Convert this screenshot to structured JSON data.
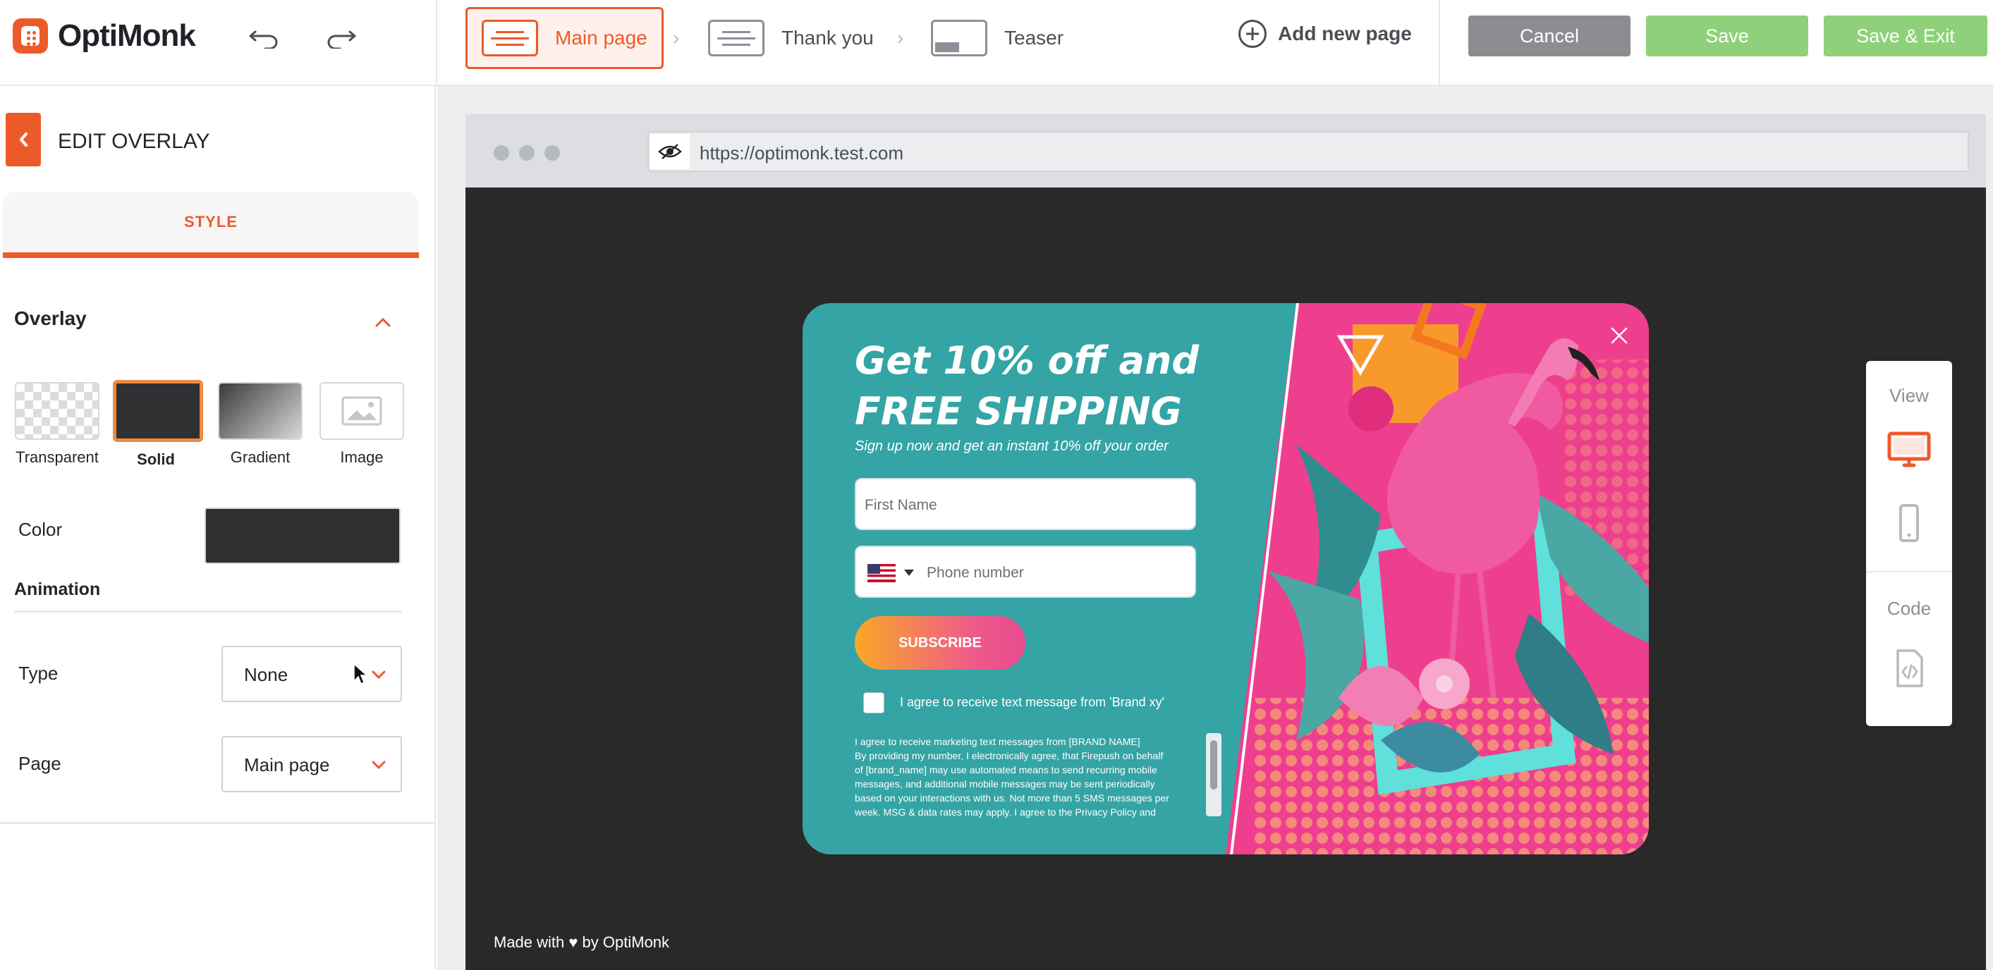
{
  "app": {
    "name": "OptiMonk"
  },
  "toolbar": {
    "undo_icon": "undo-icon",
    "redo_icon": "redo-icon",
    "pages": [
      {
        "label": "Main page",
        "active": true
      },
      {
        "label": "Thank you",
        "active": false
      },
      {
        "label": "Teaser",
        "active": false
      }
    ],
    "add_page_label": "Add new page",
    "cancel_label": "Cancel",
    "save_label": "Save",
    "save_exit_label": "Save & Exit"
  },
  "colors": {
    "accent": "#ed5a29",
    "save_green": "#8fd17a",
    "cancel_gray": "#8b8d90",
    "popup_teal": "#34a4a5",
    "popup_pink": "#ee3f8e"
  },
  "sidebar": {
    "title": "EDIT OVERLAY",
    "tab": "STYLE",
    "overlay_section": "Overlay",
    "overlay_options": [
      {
        "label": "Transparent",
        "selected": false
      },
      {
        "label": "Solid",
        "selected": true
      },
      {
        "label": "Gradient",
        "selected": false
      },
      {
        "label": "Image",
        "selected": false
      }
    ],
    "color_label": "Color",
    "color_value": "#2f3032",
    "animation_section": "Animation",
    "type_label": "Type",
    "type_value": "None",
    "page_label": "Page",
    "page_value": "Main page"
  },
  "preview": {
    "url": "https://optimonk.test.com",
    "made_with": "Made with ♥ by OptiMonk",
    "popup": {
      "headline_line1": "Get 10% off and",
      "headline_line2": "FREE SHIPPING",
      "subheadline": "Sign up now and get an instant 10% off your order",
      "first_name_placeholder": "First Name",
      "phone_placeholder": "Phone number",
      "subscribe_label": "SUBSCRIBE",
      "checkbox_label": "I agree to receive text message from 'Brand xy'",
      "legal_lines": [
        "I agree to receive marketing text messages from [BRAND NAME]",
        "By providing my number, I electronically agree, that Firepush on behalf",
        "of [brand_name] may use automated means to send recurring mobile",
        "messages, and additional mobile messages may be sent periodically",
        "based on your interactions with us. Not more than 5 SMS messages per",
        "week. MSG & data rates may apply. I agree to the Privacy Policy and"
      ]
    }
  },
  "view_panel": {
    "view_label": "View",
    "code_label": "Code",
    "active_device": "desktop"
  }
}
